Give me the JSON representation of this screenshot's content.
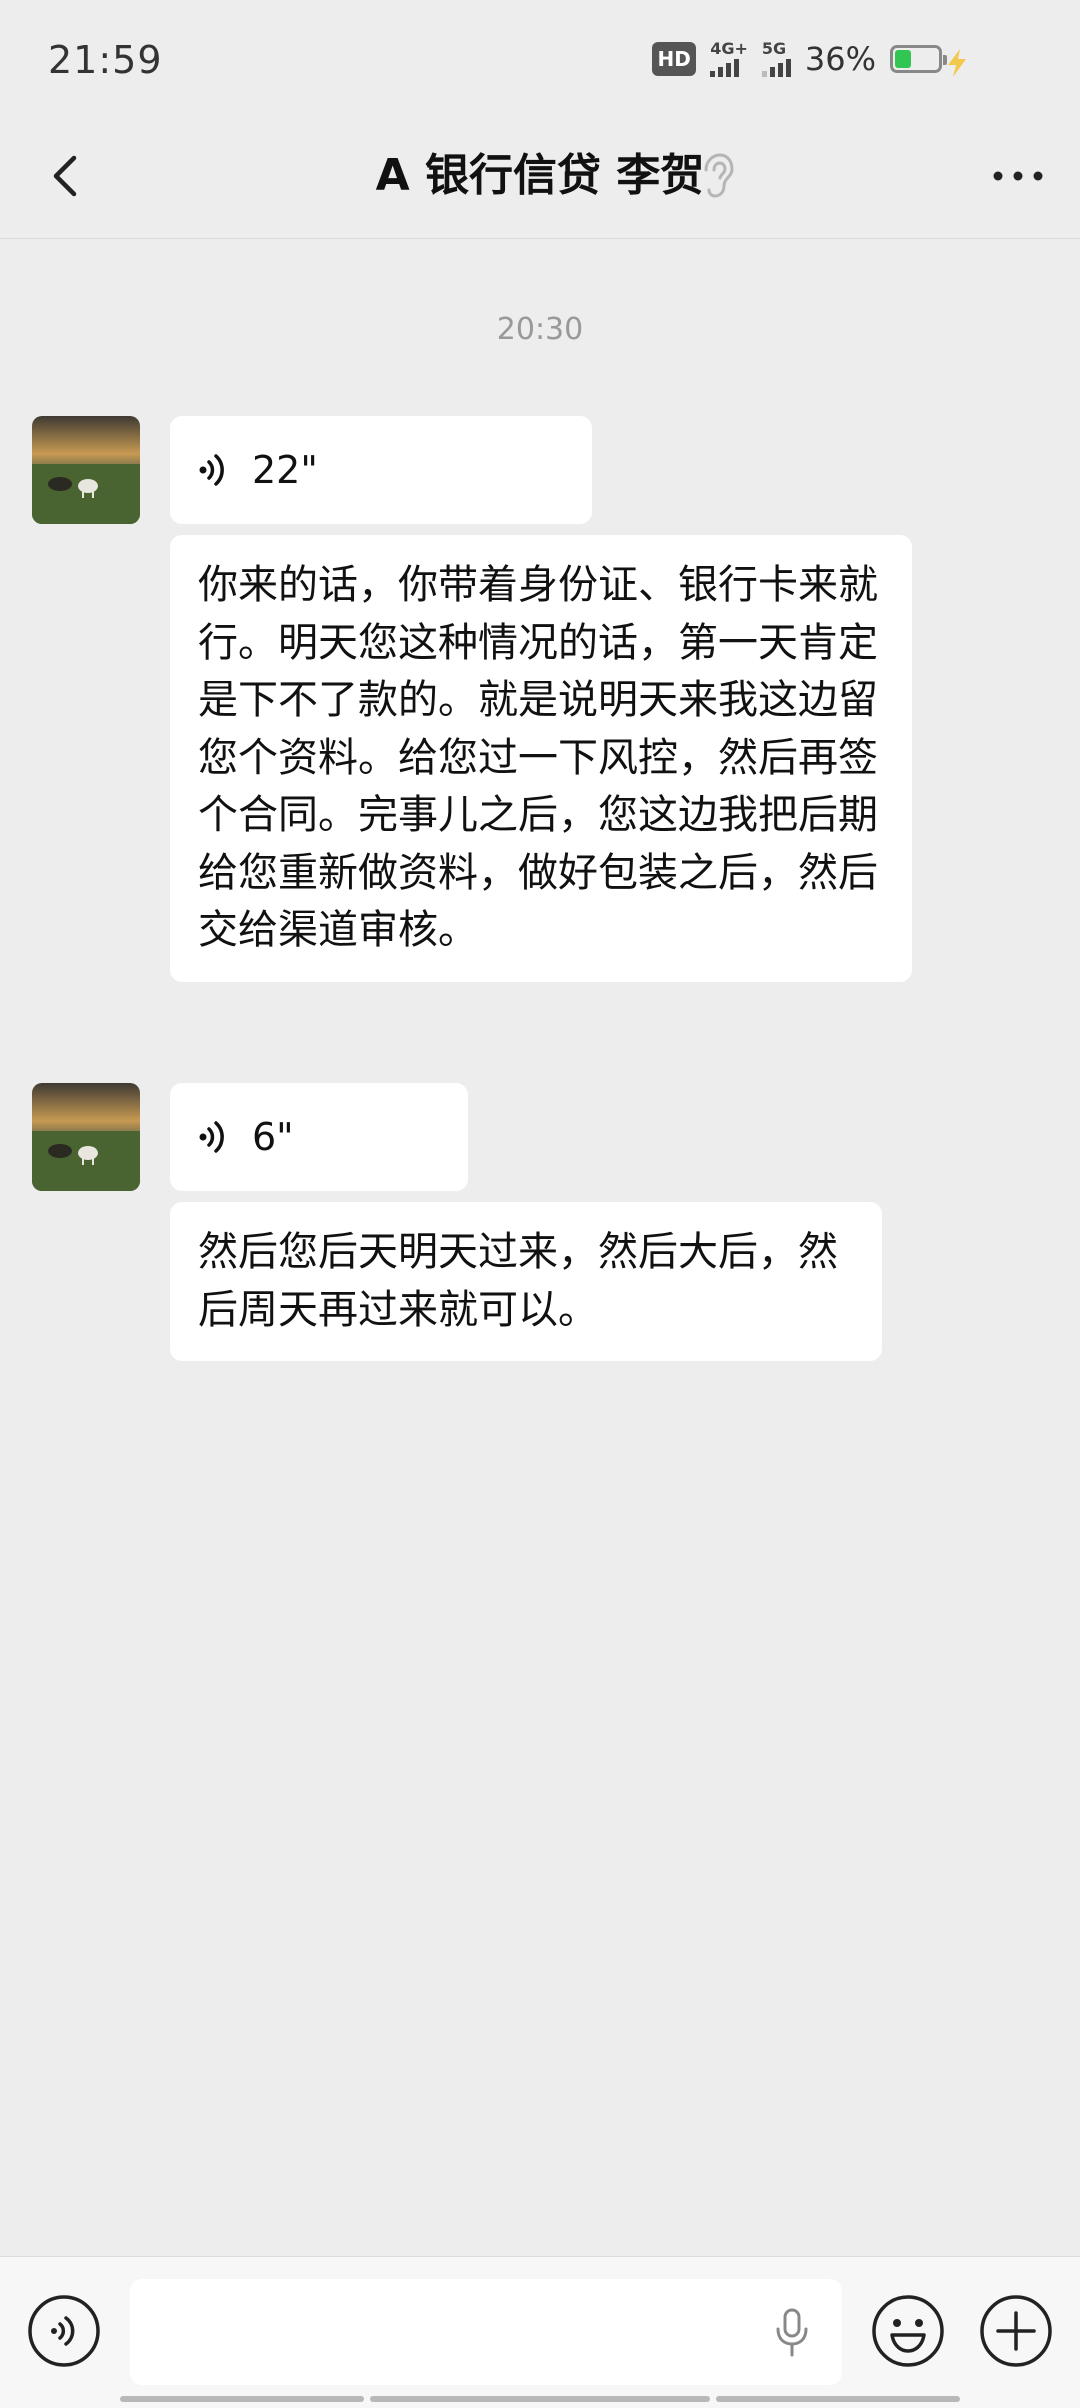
{
  "status_bar": {
    "time": "21:59",
    "hd_label": "HD",
    "net1": "4G+",
    "net2": "5G",
    "battery": "36%"
  },
  "header": {
    "title": "A 银行信贷 李贺"
  },
  "chat": {
    "timestamp": "20:30",
    "messages": [
      {
        "type": "voice",
        "duration": "22\""
      },
      {
        "type": "text",
        "text": "你来的话，你带着身份证、银行卡来就行。明天您这种情况的话，第一天肯定是下不了款的。就是说明天来我这边留您个资料。给您过一下风控，然后再签个合同。完事儿之后，您这边我把后期给您重新做资料，做好包装之后，然后交给渠道审核。"
      },
      {
        "type": "voice",
        "duration": "6\""
      },
      {
        "type": "text",
        "text": "然后您后天明天过来，然后大后，然后周天再过来就可以。"
      }
    ]
  },
  "input": {
    "placeholder": "",
    "value": ""
  },
  "colors": {
    "background": "#ededed",
    "bubble": "#ffffff",
    "battery_fill": "#31c651",
    "bolt": "#f2c94c"
  },
  "icons": [
    "back-arrow-icon",
    "ear-icon",
    "more-icon",
    "voice-wave-icon",
    "microphone-icon",
    "emoji-icon",
    "plus-icon"
  ]
}
